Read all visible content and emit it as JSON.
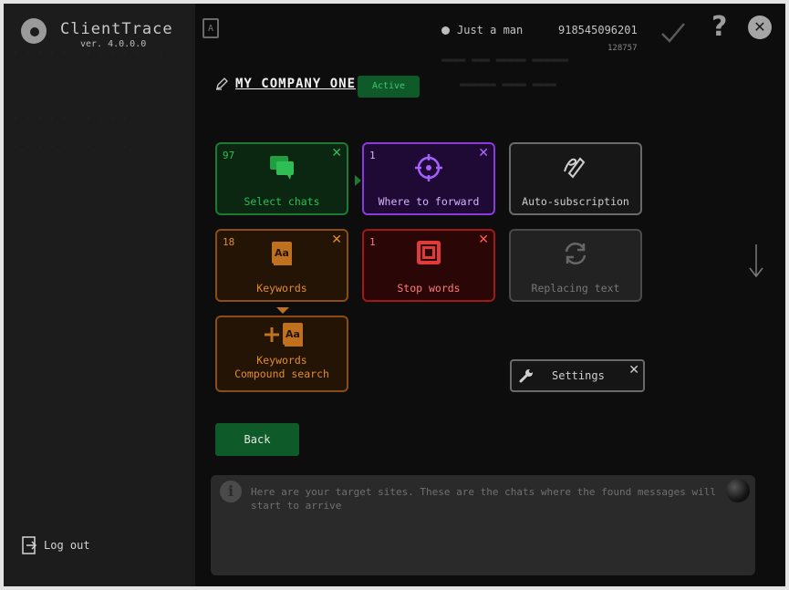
{
  "app": {
    "title": "ClientTrace",
    "version": "ver. 4.0.0.0"
  },
  "sidebar": {
    "logout_label": "Log out"
  },
  "header": {
    "user_name": "Just a man",
    "phone": "918545096201",
    "user_id": "128757",
    "help_label": "?",
    "close_label": "✕",
    "book_label": "A"
  },
  "company": {
    "name": "MY COMPANY ONE",
    "status": "Active"
  },
  "tiles": {
    "select_chats": {
      "count": "97",
      "label": "Select chats"
    },
    "where_to_forward": {
      "count": "1",
      "label": "Where to forward"
    },
    "auto_subscription": {
      "label": "Auto-subscription"
    },
    "keywords": {
      "count": "18",
      "label": "Keywords"
    },
    "stop_words": {
      "count": "1",
      "label": "Stop words"
    },
    "replacing_text": {
      "label": "Replacing text"
    },
    "compound_search": {
      "label_line1": "Keywords",
      "label_line2": "Compound search"
    },
    "close_label": "✕"
  },
  "settings": {
    "label": "Settings"
  },
  "back_label": "Back",
  "info": {
    "icon_label": "i",
    "text": "Here are your target sites. These are the chats where the found messages will start to arrive"
  },
  "colors": {
    "green": "#2fbd56",
    "purple": "#8a39dc",
    "orange": "#e38c2a",
    "red": "#d82a2a",
    "active_badge_bg": "#0e5b29"
  }
}
